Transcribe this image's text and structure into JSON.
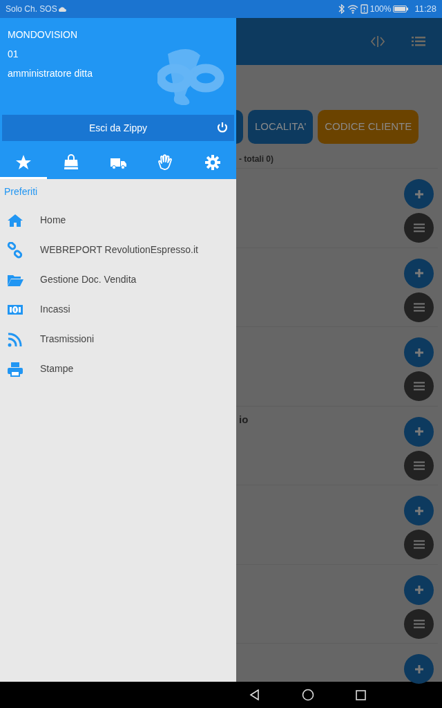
{
  "status_bar": {
    "carrier": "Solo Ch. SOS",
    "battery": "100%",
    "time": "11:28"
  },
  "drawer": {
    "company": "MONDOVISION",
    "code": "01",
    "role": "amministratore ditta",
    "logout": "Esci da Zippy",
    "tabs": [
      {
        "kind": "star",
        "selected": true
      },
      {
        "kind": "bag",
        "selected": false
      },
      {
        "kind": "truck",
        "selected": false
      },
      {
        "kind": "hand",
        "selected": false
      },
      {
        "kind": "gear",
        "selected": false
      }
    ],
    "section": "Preferiti",
    "items": [
      {
        "kind": "home",
        "label": "Home"
      },
      {
        "kind": "link",
        "label": "WEBREPORT RevolutionEspresso.it"
      },
      {
        "kind": "folder",
        "label": "Gestione Doc. Vendita"
      },
      {
        "kind": "money",
        "label": "Incassi"
      },
      {
        "kind": "rss",
        "label": "Trasmissioni"
      },
      {
        "kind": "print",
        "label": "Stampe"
      }
    ]
  },
  "background": {
    "filters": [
      {
        "label": "LOCALITA'",
        "color": "#0d3a5f"
      },
      {
        "label": "CODICE CLIENTE",
        "color": "#6b4300"
      }
    ],
    "summary": "- totali 0)",
    "rows": [
      {
        "has_menu": true
      },
      {
        "has_menu": true
      },
      {
        "has_menu": true
      },
      {
        "title": "io",
        "has_menu": true
      },
      {
        "has_menu": true
      },
      {
        "has_menu": true
      },
      {
        "has_menu": false
      }
    ]
  }
}
